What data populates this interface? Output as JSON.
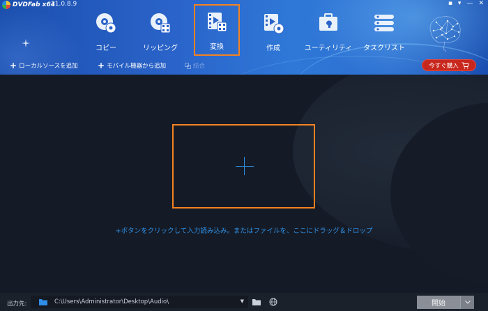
{
  "app": {
    "logo_text": "DVDFab x64",
    "version": "11.0.8.9"
  },
  "window_controls": [
    "▪",
    "▾",
    "—",
    "✕"
  ],
  "nav": {
    "items": [
      {
        "label": "コピー",
        "icon": "disc-copy-icon"
      },
      {
        "label": "リッピング",
        "icon": "disc-rip-icon"
      },
      {
        "label": "変換",
        "icon": "film-convert-icon",
        "active": true
      },
      {
        "label": "作成",
        "icon": "film-create-icon"
      },
      {
        "label": "ユーティリティ",
        "icon": "toolbox-icon"
      },
      {
        "label": "タスクリスト",
        "icon": "task-list-icon"
      }
    ]
  },
  "toolbar": {
    "add_local_source": "ローカルソースを追加",
    "add_mobile_device": "モバイル機器から追加",
    "merge": "結合",
    "buy_now": "今すぐ購入"
  },
  "main": {
    "hint": "+ボタンをクリックして入力読み込み。またはファイルを、ここにドラッグ＆ドロップ"
  },
  "bottom": {
    "output_label": "出力先:",
    "output_path": "C:\\Users\\Administrator\\Desktop\\Audio\\",
    "start_label": "開始"
  },
  "colors": {
    "highlight": "#f58220",
    "accent_blue": "#2f8ee6",
    "buy_red": "#c8271d"
  }
}
